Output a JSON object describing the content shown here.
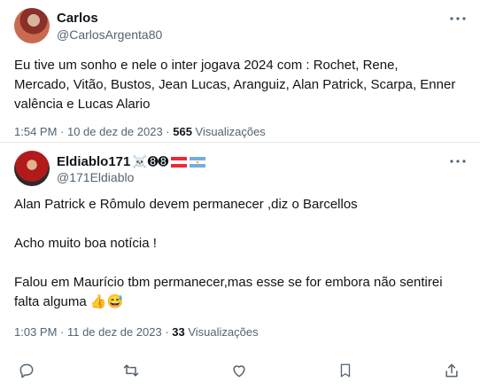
{
  "posts": [
    {
      "name": "Carlos",
      "handle": "@CarlosArgenta80",
      "text": "Eu tive um sonho e nele o inter jogava 2024 com : Rochet, Rene, Mercado, Vitão, Bustos, Jean Lucas, Aranguiz, Alan Patrick, Scarpa, Enner valência e Lucas Alario",
      "time": "1:54 PM · 10 de dez de 2023 · ",
      "views": "565",
      "views_label": " Visualizações"
    },
    {
      "name": "Eldiablo171",
      "handle": "@171Eldiablo",
      "badges": "☠️➑➑",
      "text": "Alan Patrick e Rômulo devem permanecer ,diz o Barcellos\n\nAcho muito boa notícia !\n\nFalou em Maurício tbm permanecer,mas esse se for embora não sentirei falta alguma 👍😅",
      "time": "1:03 PM · 11 de dez de 2023 · ",
      "views": "33",
      "views_label": " Visualizações"
    }
  ],
  "actions": [
    "reply-icon",
    "retweet-icon",
    "like-icon",
    "bookmark-icon",
    "share-icon"
  ],
  "colors": {
    "text": "#0f1419",
    "secondary": "#536471",
    "divider": "#e7e9eb"
  }
}
